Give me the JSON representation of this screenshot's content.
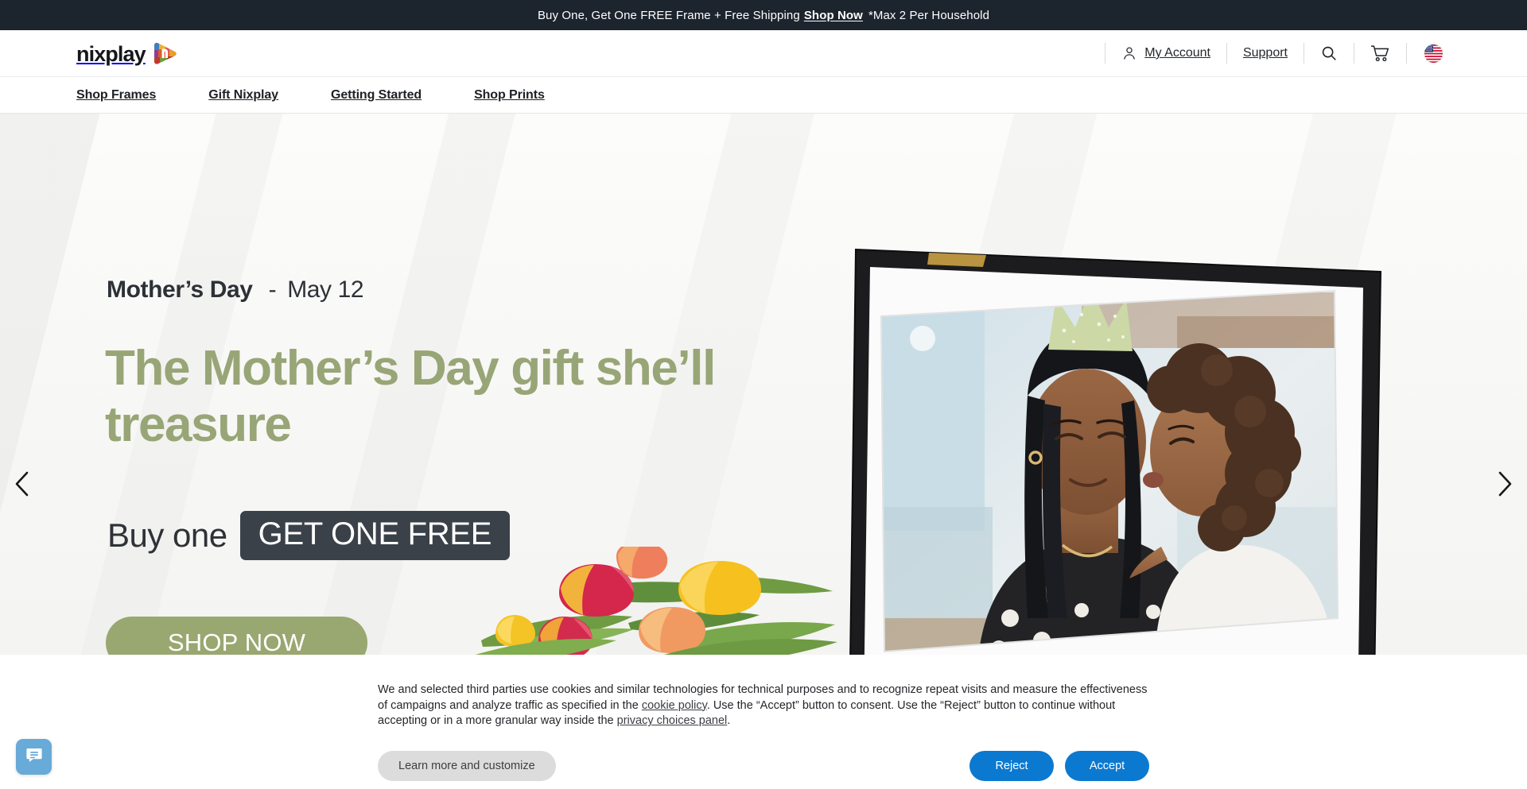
{
  "announcement": {
    "text_before": "Buy One, Get One FREE Frame + Free Shipping",
    "link": "Shop Now",
    "text_after": "*Max 2 Per Household"
  },
  "header": {
    "logo_word": "nixplay",
    "logo_icon": "nixplay-play-mark",
    "account_label": "My Account",
    "account_icon": "person-icon",
    "support_label": "Support",
    "search_icon": "search-icon",
    "cart_icon": "shopping-cart-icon",
    "locale_icon": "us-flag-icon"
  },
  "nav": {
    "items": [
      {
        "label": "Shop Frames"
      },
      {
        "label": "Gift Nixplay"
      },
      {
        "label": "Getting Started"
      },
      {
        "label": "Shop Prints"
      }
    ]
  },
  "hero": {
    "eyebrow_title": "Mother’s Day",
    "eyebrow_dash": "-",
    "eyebrow_date": "May 12",
    "headline": "The Mother’s Day gift she’ll treasure",
    "buy_one_label": "Buy one",
    "badge_label": "GET ONE FREE",
    "cta_label": "SHOP NOW",
    "prev_icon": "chevron-left-icon",
    "next_icon": "chevron-right-icon",
    "slides_total": 3,
    "active_slide": 1,
    "colors": {
      "headline_green": "#98a576",
      "cta_green": "#99a770",
      "badge_dark": "#3a4149",
      "dot_active": "#1e8fae",
      "dot_inactive": "#a7aab0"
    }
  },
  "cookie_banner": {
    "paragraph_1": "We and selected third parties use cookies and similar technologies for technical purposes and to recognize repeat visits and measure the effectiveness of campaigns and analyze traffic as specified in the ",
    "link_cookie_policy": "cookie policy",
    "paragraph_2": ". Use the “Accept” button to consent. Use the “Reject” button to continue without accepting or in a more granular way inside the ",
    "link_privacy_panel": "privacy choices panel",
    "paragraph_3": ".",
    "learn_more_label": "Learn more and customize",
    "reject_label": "Reject",
    "accept_label": "Accept",
    "accent_blue": "#0b79d0"
  },
  "chat": {
    "icon": "chat-bubble-icon",
    "color": "#68aad8"
  }
}
